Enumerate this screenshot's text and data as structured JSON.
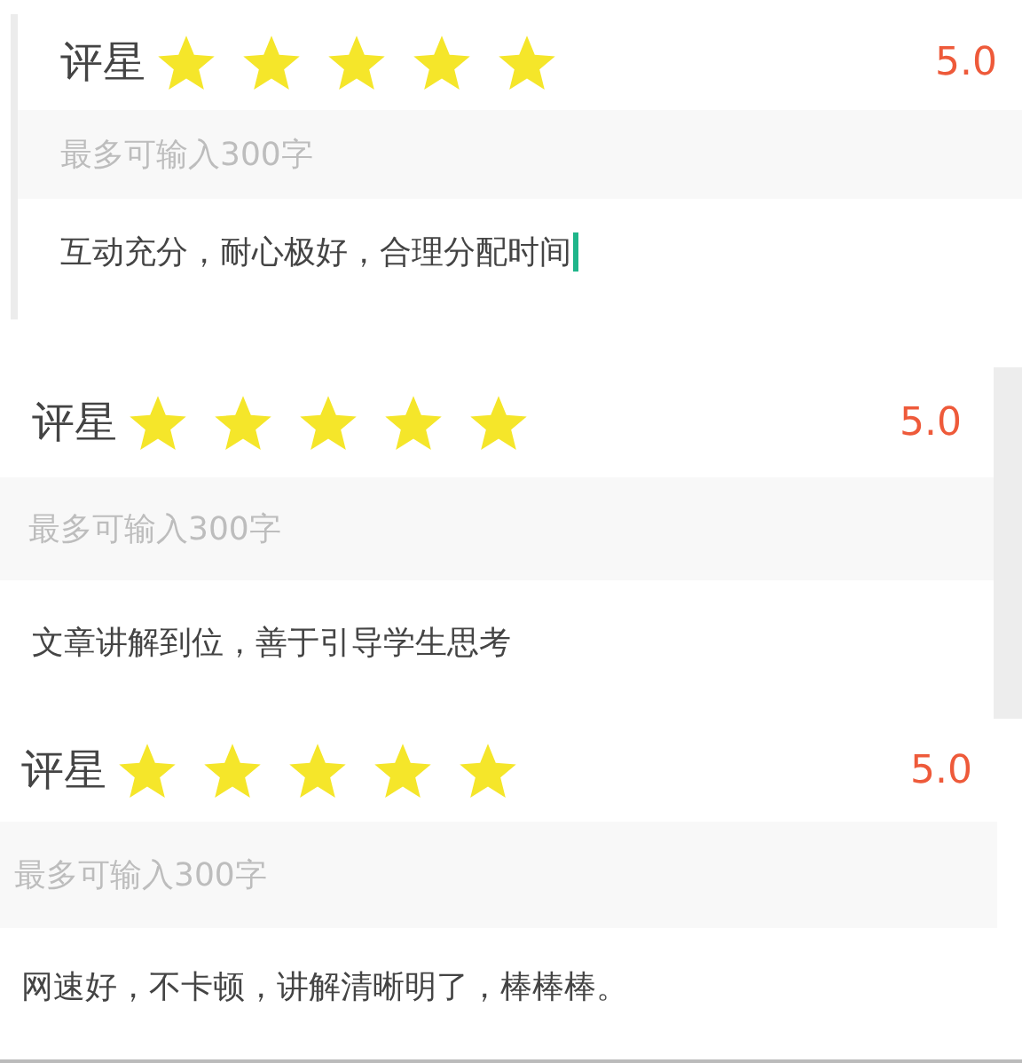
{
  "panels": [
    {
      "label": "评星",
      "stars": 5,
      "score": "5.0",
      "placeholder": "最多可输入300字",
      "comment": "互动充分，耐心极好，合理分配时间",
      "cursor": true
    },
    {
      "label": "评星",
      "stars": 5,
      "score": "5.0",
      "placeholder": "最多可输入300字",
      "comment": "文章讲解到位，善于引导学生思考",
      "cursor": false
    },
    {
      "label": "评星",
      "stars": 5,
      "score": "5.0",
      "placeholder": "最多可输入300字",
      "comment": "网速好，不卡顿，讲解清晰明了，棒棒棒。",
      "cursor": false
    }
  ]
}
